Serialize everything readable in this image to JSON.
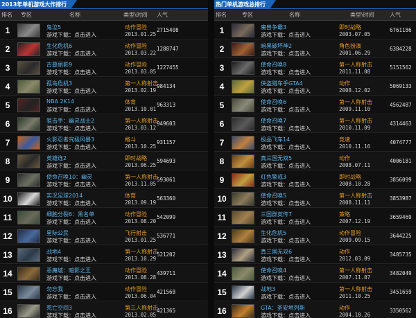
{
  "colors": {
    "accent": "#1b63b8",
    "name": "#5fb3e8",
    "type": "#e59a1d"
  },
  "left": {
    "title": "2013年单机游戏大作排行",
    "headers": {
      "rank": "排名",
      "zone": "专区",
      "name": "名称",
      "type": "类型\\时间",
      "pop": "人气"
    },
    "rows": [
      {
        "rank": "1",
        "name": "鬼泣5",
        "sub_label": "游戏下载：",
        "sub_action": "点击进入",
        "type": "动作冒险",
        "date": "2013.01.25",
        "pop": "2715408",
        "thumb": [
          "#3a3a3a",
          "#8a8a8a"
        ]
      },
      {
        "rank": "2",
        "name": "生化危机6",
        "sub_label": "游戏下载：",
        "sub_action": "点击进入",
        "type": "动作冒险",
        "date": "2013.03.22",
        "pop": "1288747",
        "thumb": [
          "#222",
          "#b33"
        ]
      },
      {
        "rank": "3",
        "name": "古墓丽影9",
        "sub_label": "游戏下载：",
        "sub_action": "点击进入",
        "type": "动作冒险",
        "date": "2013.03.05",
        "pop": "1227455",
        "thumb": [
          "#5a5040",
          "#2a2a2a"
        ]
      },
      {
        "rank": "4",
        "name": "孤岛危机3",
        "sub_label": "游戏下载：",
        "sub_action": "点击进入",
        "type": "第一人称射击",
        "date": "2013.02.19",
        "pop": "984134",
        "thumb": [
          "#4d5a3a",
          "#8a8a6a"
        ]
      },
      {
        "rank": "5",
        "name": "NBA 2K14",
        "sub_label": "游戏下载：",
        "sub_action": "点击进入",
        "type": "体育",
        "date": "2013.10.01",
        "pop": "963313",
        "thumb": [
          "#552222",
          "#222"
        ]
      },
      {
        "rank": "6",
        "name": "狙击手：幽灵战士2",
        "sub_label": "游戏下载：",
        "sub_action": "点击进入",
        "type": "第一人称射击",
        "date": "2013.03.12",
        "pop": "949603",
        "thumb": [
          "#2a3a2a",
          "#7a7a6a"
        ]
      },
      {
        "rank": "7",
        "name": "火影忍者究极风暴3",
        "sub_label": "游戏下载：",
        "sub_action": "点击进入",
        "type": "格斗",
        "date": "2013.10.25",
        "pop": "931157",
        "thumb": [
          "#c8641e",
          "#3a5aa0"
        ]
      },
      {
        "rank": "8",
        "name": "英雄连2",
        "sub_label": "游戏下载：",
        "sub_action": "点击进入",
        "type": "即时战略",
        "date": "2013.06.25",
        "pop": "594693",
        "thumb": [
          "#6a5a3a",
          "#2a2a2a"
        ]
      },
      {
        "rank": "9",
        "name": "使命召唤10：幽灵",
        "sub_label": "游戏下载：",
        "sub_action": "点击进入",
        "type": "第一人称射击",
        "date": "2013.11.05",
        "pop": "593061",
        "thumb": [
          "#2a2a2a",
          "#6a7060"
        ]
      },
      {
        "rank": "10",
        "name": "实况足球2014",
        "sub_label": "游戏下载：",
        "sub_action": "点击进入",
        "type": "体育",
        "date": "2013.09.19",
        "pop": "563360",
        "thumb": [
          "#1a1a1a",
          "#d8d8d8"
        ]
      },
      {
        "rank": "11",
        "name": "细胞分裂6：黑名单",
        "sub_label": "游戏下载：",
        "sub_action": "点击进入",
        "type": "动作冒险",
        "date": "2013.08.20",
        "pop": "542099",
        "thumb": [
          "#3a4a3a",
          "#6a6a5a"
        ]
      },
      {
        "rank": "12",
        "name": "星际公民",
        "sub_label": "游戏下载：",
        "sub_action": "点击进入",
        "type": "飞行射击",
        "date": "2013.01.25",
        "pop": "536771",
        "thumb": [
          "#1e2a4a",
          "#4a6a9a"
        ]
      },
      {
        "rank": "13",
        "name": "战地4",
        "sub_label": "游戏下载：",
        "sub_action": "点击进入",
        "type": "第一人称射击",
        "date": "2013.10.29",
        "pop": "521202",
        "thumb": [
          "#5a6a7a",
          "#2a3a4a"
        ]
      },
      {
        "rank": "14",
        "name": "恶魔城：暗影之王",
        "sub_label": "游戏下载：",
        "sub_action": "点击进入",
        "type": "动作冒险",
        "date": "2013.08.28",
        "pop": "439711",
        "thumb": [
          "#3a2a1a",
          "#8a6a3a"
        ]
      },
      {
        "rank": "15",
        "name": "勿忘我",
        "sub_label": "游戏下载：",
        "sub_action": "点击进入",
        "type": "动作冒险",
        "date": "2013.06.04",
        "pop": "421568",
        "thumb": [
          "#2a3a4a",
          "#7a8a9a"
        ]
      },
      {
        "rank": "16",
        "name": "死亡空间3",
        "sub_label": "游戏下载：",
        "sub_action": "点击进入",
        "type": "第三人称射击",
        "date": "2013.02.05",
        "pop": "421365",
        "thumb": [
          "#2a2a2a",
          "#9a9a8a"
        ]
      }
    ]
  },
  "right": {
    "title": "热门单机游戏总排行",
    "headers": {
      "rank": "排名",
      "zone": "专区",
      "name": "名称",
      "type": "类型\\时间",
      "pop": "人气"
    },
    "rows": [
      {
        "rank": "1",
        "name": "魔兽争霸3",
        "sub_label": "游戏下载：",
        "sub_action": "点击进入",
        "type": "即时战略",
        "date": "2003.07.05",
        "pop": "6761186",
        "thumb": [
          "#2a2a3a",
          "#7a6a5a"
        ]
      },
      {
        "rank": "2",
        "name": "暗黑破坏神2",
        "sub_label": "游戏下载：",
        "sub_action": "点击进入",
        "type": "角色扮演",
        "date": "2001.06.29",
        "pop": "6384228",
        "thumb": [
          "#3a1a1a",
          "#a06030"
        ]
      },
      {
        "rank": "3",
        "name": "使命召唤8",
        "sub_label": "游戏下载：",
        "sub_action": "点击进入",
        "type": "第一人称射击",
        "date": "2011.11.08",
        "pop": "5151562",
        "thumb": [
          "#1a1a1a",
          "#6a6a6a"
        ]
      },
      {
        "rank": "4",
        "name": "侠盗猎车手GTA4",
        "sub_label": "游戏下载：",
        "sub_action": "点击进入",
        "type": "动作",
        "date": "2008.12.02",
        "pop": "5069133",
        "thumb": [
          "#5a6a3a",
          "#c0a040"
        ]
      },
      {
        "rank": "5",
        "name": "使命召唤6",
        "sub_label": "游戏下载：",
        "sub_action": "点击进入",
        "type": "第一人称射击",
        "date": "2009.11.10",
        "pop": "4562487",
        "thumb": [
          "#4a4a3a",
          "#8a8a7a"
        ]
      },
      {
        "rank": "6",
        "name": "使命召唤7",
        "sub_label": "游戏下载：",
        "sub_action": "点击进入",
        "type": "第一人称射击",
        "date": "2010.11.09",
        "pop": "4314463",
        "thumb": [
          "#2a2a2a",
          "#5a5a5a"
        ]
      },
      {
        "rank": "7",
        "name": "极品飞车14",
        "sub_label": "游戏下载：",
        "sub_action": "点击进入",
        "type": "竞速",
        "date": "2010.11.16",
        "pop": "4074777",
        "thumb": [
          "#3a4a6a",
          "#c08040"
        ]
      },
      {
        "rank": "8",
        "name": "真三国无双5",
        "sub_label": "游戏下载：",
        "sub_action": "点击进入",
        "type": "动作",
        "date": "2008.07.11",
        "pop": "4006181",
        "thumb": [
          "#6a3a1a",
          "#c09040"
        ]
      },
      {
        "rank": "9",
        "name": "红色警戒3",
        "sub_label": "游戏下载：",
        "sub_action": "点击进入",
        "type": "即时战略",
        "date": "2008.10.28",
        "pop": "3856099",
        "thumb": [
          "#8a2a1a",
          "#c0a040"
        ]
      },
      {
        "rank": "10",
        "name": "使命召唤5",
        "sub_label": "游戏下载：",
        "sub_action": "点击进入",
        "type": "第一人称射击",
        "date": "2008.11.11",
        "pop": "3853987",
        "thumb": [
          "#3a3a2a",
          "#8a7a5a"
        ]
      },
      {
        "rank": "11",
        "name": "三国群英传7",
        "sub_label": "游戏下载：",
        "sub_action": "点击进入",
        "type": "策略",
        "date": "2007.12.19",
        "pop": "3659469",
        "thumb": [
          "#5a4a2a",
          "#a08050"
        ]
      },
      {
        "rank": "12",
        "name": "生化危机5",
        "sub_label": "游戏下载：",
        "sub_action": "点击进入",
        "type": "动作冒险",
        "date": "2009.09.15",
        "pop": "3644225",
        "thumb": [
          "#4a3a1a",
          "#b08040"
        ]
      },
      {
        "rank": "13",
        "name": "真三国无双6",
        "sub_label": "游戏下载：",
        "sub_action": "点击进入",
        "type": "动作",
        "date": "2012.03.09",
        "pop": "3485735",
        "thumb": [
          "#2a2a3a",
          "#b0a080"
        ]
      },
      {
        "rank": "14",
        "name": "使命召唤4",
        "sub_label": "游戏下载：",
        "sub_action": "点击进入",
        "type": "第一人称射击",
        "date": "2007.11.07",
        "pop": "3482049",
        "thumb": [
          "#4a5a3a",
          "#8a8a6a"
        ]
      },
      {
        "rank": "15",
        "name": "战地3",
        "sub_label": "游戏下载：",
        "sub_action": "点击进入",
        "type": "第一人称射击",
        "date": "2011.10.25",
        "pop": "3451659",
        "thumb": [
          "#2a3a4a",
          "#d0d0d0"
        ]
      },
      {
        "rank": "16",
        "name": "GTA：圣安地列斯",
        "sub_label": "游戏下载：",
        "sub_action": "点击进入",
        "type": "动作",
        "date": "2004.10.26",
        "pop": "3350562",
        "thumb": [
          "#3a2a1a",
          "#c08030"
        ]
      }
    ]
  }
}
